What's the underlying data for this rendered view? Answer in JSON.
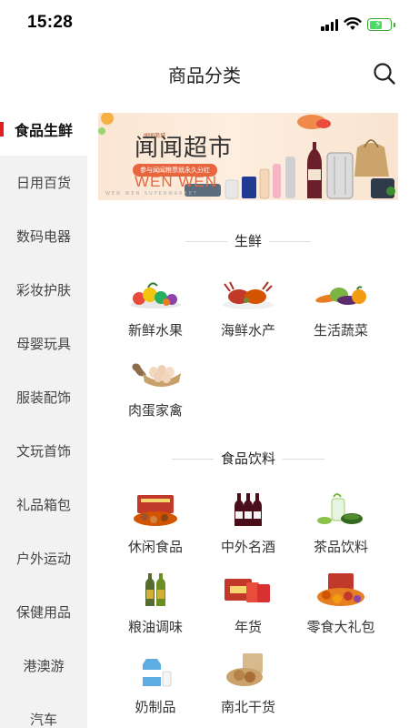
{
  "status_bar": {
    "time": "15:28"
  },
  "header": {
    "title": "商品分类"
  },
  "sidebar": {
    "items": [
      {
        "label": "食品生鲜",
        "active": true
      },
      {
        "label": "日用百货"
      },
      {
        "label": "数码电器"
      },
      {
        "label": "彩妆护肤"
      },
      {
        "label": "母婴玩具"
      },
      {
        "label": "服装配饰"
      },
      {
        "label": "文玩首饰"
      },
      {
        "label": "礼品箱包"
      },
      {
        "label": "户外运动"
      },
      {
        "label": "保健用品"
      },
      {
        "label": "港澳游"
      },
      {
        "label": "汽车"
      }
    ]
  },
  "banner": {
    "brand_small": "闻闻商城",
    "title": "闻闻超市",
    "pill": "参与闻闻粮票就永久分红",
    "english": "WEN WEN",
    "tagline": "WEN WEN SUPERMARKET"
  },
  "sections": [
    {
      "title": "生鲜",
      "items": [
        {
          "label": "新鲜水果",
          "icon": "fruit-icon"
        },
        {
          "label": "海鲜水产",
          "icon": "seafood-icon"
        },
        {
          "label": "生活蔬菜",
          "icon": "vegetable-icon"
        },
        {
          "label": "肉蛋家禽",
          "icon": "eggs-icon"
        }
      ]
    },
    {
      "title": "食品饮料",
      "items": [
        {
          "label": "休闲食品",
          "icon": "snacks-icon"
        },
        {
          "label": "中外名酒",
          "icon": "wine-icon"
        },
        {
          "label": "茶品饮料",
          "icon": "tea-icon"
        },
        {
          "label": "粮油调味",
          "icon": "oil-icon"
        },
        {
          "label": "年货",
          "icon": "gift-box-icon"
        },
        {
          "label": "零食大礼包",
          "icon": "snack-pack-icon"
        },
        {
          "label": "奶制品",
          "icon": "milk-icon"
        },
        {
          "label": "南北干货",
          "icon": "dried-goods-icon"
        }
      ]
    }
  ],
  "colors": {
    "accent": "#e02020",
    "sidebar_bg": "#f2f2f2",
    "banner_orange": "#e8663d"
  }
}
